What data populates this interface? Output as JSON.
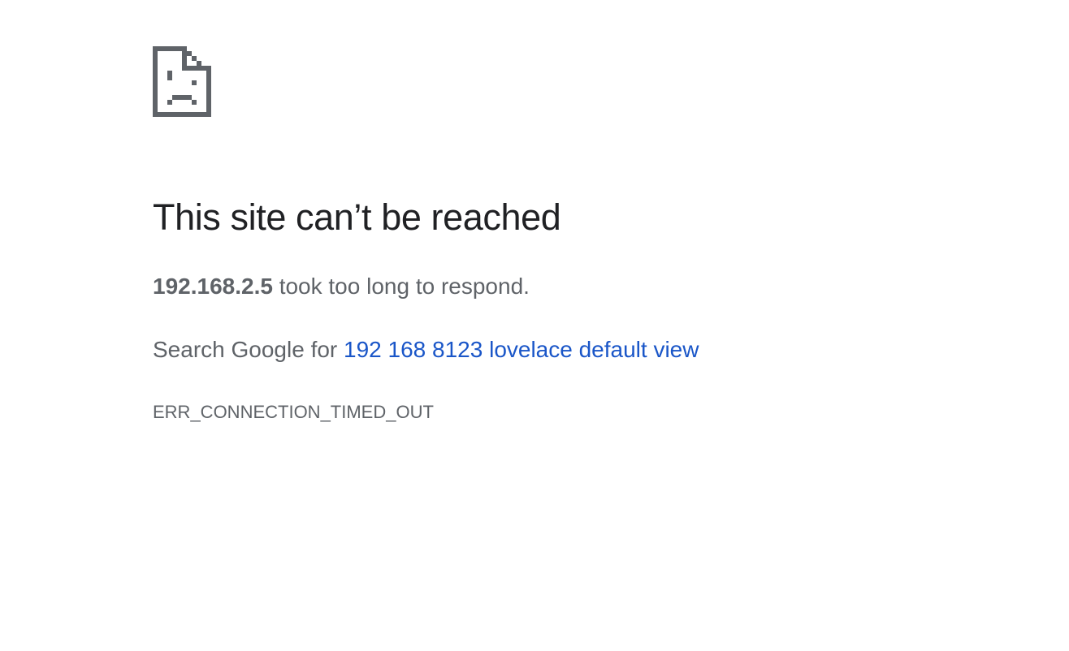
{
  "error_page": {
    "icon": "sad-page-icon",
    "icon_color": "#5f6368",
    "heading": "This site can’t be reached",
    "host": "192.168.2.5",
    "summary_suffix": " took too long to respond.",
    "suggestion_prefix": "Search Google for ",
    "search_query": "192 168 8123 lovelace default view",
    "error_code": "ERR_CONNECTION_TIMED_OUT",
    "link_color": "#1a56c8",
    "text_color": "#5f6368",
    "heading_color": "#202124"
  }
}
